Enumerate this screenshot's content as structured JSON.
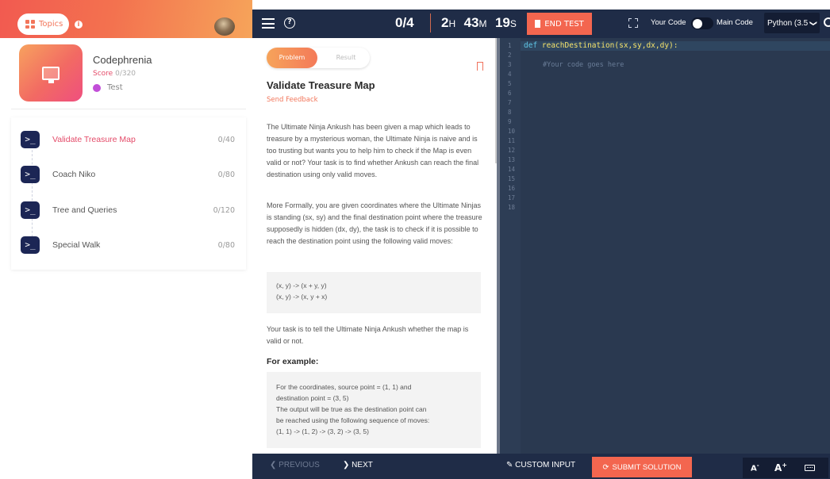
{
  "sidebar": {
    "topics_label": "Topics",
    "info_glyph": "i",
    "course": {
      "title": "Codephrenia",
      "score_label": "Score",
      "score_value": "0/320",
      "mode": "Test",
      "icon": "monitor-icon"
    },
    "problems": [
      {
        "name": "Validate Treasure Map",
        "score": "0/40",
        "active": true,
        "icon": "terminal-icon",
        "glyph": ">_"
      },
      {
        "name": "Coach Niko",
        "score": "0/80",
        "active": false,
        "icon": "terminal-icon",
        "glyph": ">_"
      },
      {
        "name": "Tree and Queries",
        "score": "0/120",
        "active": false,
        "icon": "terminal-icon",
        "glyph": ">_"
      },
      {
        "name": "Special Walk",
        "score": "0/80",
        "active": false,
        "icon": "terminal-icon",
        "glyph": ">_"
      }
    ]
  },
  "topbar": {
    "help_glyph": "?",
    "progress": "0/4",
    "timer": {
      "hours": "2",
      "hours_unit": "H",
      "minutes": "43",
      "minutes_unit": "M",
      "seconds": "19",
      "seconds_unit": "S"
    },
    "end_test_label": "END TEST",
    "your_code_label": "Your Code",
    "main_code_label": "Main Code",
    "language": "Python (3.5",
    "language_chevron": "❯"
  },
  "problem": {
    "tabs": {
      "problem": "Problem",
      "result": "Result"
    },
    "title": "Validate Treasure Map",
    "send_feedback": "Send Feedback",
    "paragraph1": "The Ultimate Ninja Ankush has been given a map which leads to treasure by a mysterious woman, the Ultimate Ninja is naive and is too trusting but wants you to help him to check if the Map is even valid or not? Your task is to find whether Ankush can reach the final destination using only valid moves.",
    "paragraph2": "More Formally, you are given coordinates where the Ultimate Ninjas is standing (sx, sy) and the final destination point where the treasure supposedly is hidden (dx, dy), the task is to check if it is possible to reach the destination point using the following valid moves:",
    "moves": [
      "(x, y) -> (x + y, y)",
      "(x, y) -> (x, y + x)"
    ],
    "paragraph3": "Your task is to tell the Ultimate Ninja Ankush whether the map is valid or not.",
    "example_heading": "For example:",
    "example_lines": [
      "For the coordinates, source point = (1, 1) and",
      "destination point = (3, 5)",
      "The output will be true as the destination point can",
      "be reached using the following sequence of moves:",
      "(1, 1) -> (1, 2) -> (3, 2) -> (3, 5)"
    ]
  },
  "editor": {
    "line_numbers": [
      "1",
      "2",
      "3",
      "4",
      "5",
      "6",
      "7",
      "8",
      "9",
      "10",
      "11",
      "12",
      "13",
      "14",
      "15",
      "16",
      "17",
      "18"
    ],
    "code_keyword": "def",
    "code_signature": " reachDestination(sx,sy,dx,dy):",
    "code_comment": "#Your code goes here"
  },
  "bottombar": {
    "previous_label": "PREVIOUS",
    "previous_glyph": "❮",
    "next_label": "NEXT",
    "next_glyph": "❯",
    "custom_input_label": "CUSTOM INPUT",
    "custom_input_glyph": "✎",
    "submit_label": "SUBMIT SOLUTION",
    "submit_glyph": "⟳",
    "font_decrease": "A",
    "font_decrease_mark": "-",
    "font_increase": "A",
    "font_increase_mark": "+"
  },
  "colors": {
    "accent": "#f3664f",
    "active_text": "#e44b69",
    "topbar_bg": "#1f2c47",
    "editor_bg": "#2a3950"
  }
}
